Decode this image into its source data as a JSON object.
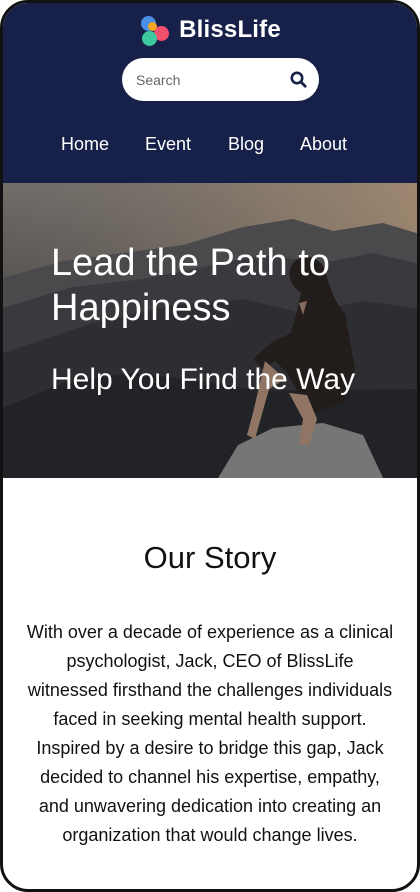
{
  "header": {
    "brand": "BlissLife",
    "logo_colors": [
      "#4a8fe7",
      "#f0506e",
      "#3cc9a0",
      "#f5a623"
    ],
    "search": {
      "placeholder": "Search",
      "value": ""
    },
    "nav": [
      "Home",
      "Event",
      "Blog",
      "About"
    ],
    "background": "#172048"
  },
  "hero": {
    "title": "Lead the Path to Happiness",
    "subtitle": "Help You Find the Way"
  },
  "story": {
    "title": "Our Story",
    "text": "With over a decade of experience as a clinical psychologist, Jack, CEO of BlissLife witnessed firsthand the challenges individuals faced in seeking mental health support. Inspired by a desire to bridge this gap, Jack decided to channel his expertise, empathy, and unwavering dedication into creating an organization that would change lives."
  }
}
